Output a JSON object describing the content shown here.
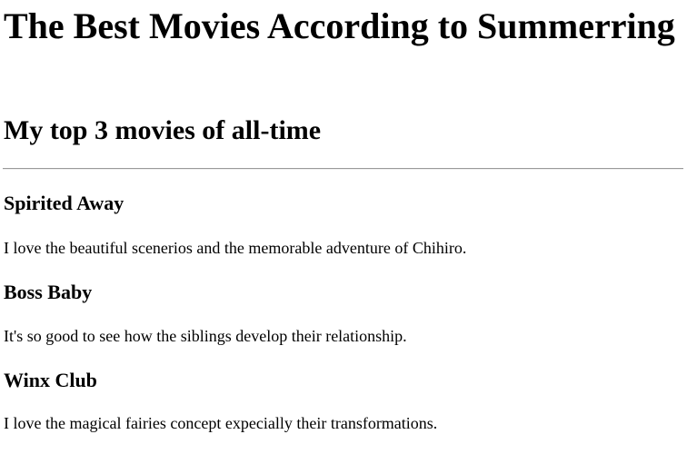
{
  "page": {
    "title": "The Best Movies According to Summerring",
    "subtitle": "My top 3 movies of all-time"
  },
  "movies": [
    {
      "title": "Spirited Away",
      "description": "I love the beautiful scenerios and the memorable adventure of Chihiro."
    },
    {
      "title": "Boss Baby",
      "description": "It's so good to see how the siblings develop their relationship."
    },
    {
      "title": "Winx Club",
      "description": "I love the magical fairies concept expecially their transformations."
    }
  ]
}
